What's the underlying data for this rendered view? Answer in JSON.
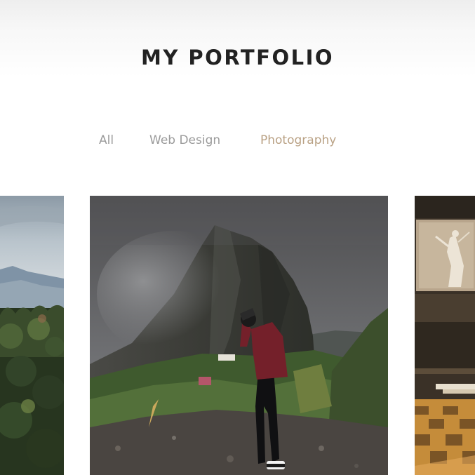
{
  "header": {
    "title": "MY PORTFOLIO"
  },
  "filters": {
    "items": [
      {
        "label": "All",
        "active": false
      },
      {
        "label": "Web Design",
        "active": false
      },
      {
        "label": "Photography",
        "active": true
      }
    ],
    "colors": {
      "inactive": "#9b9b9b",
      "active": "#b9a184"
    }
  },
  "gallery": {
    "items": [
      {
        "subject": "mountain-landscape-photo"
      },
      {
        "subject": "hiker-mountain-photo"
      },
      {
        "subject": "museum-interior-photo"
      }
    ]
  }
}
